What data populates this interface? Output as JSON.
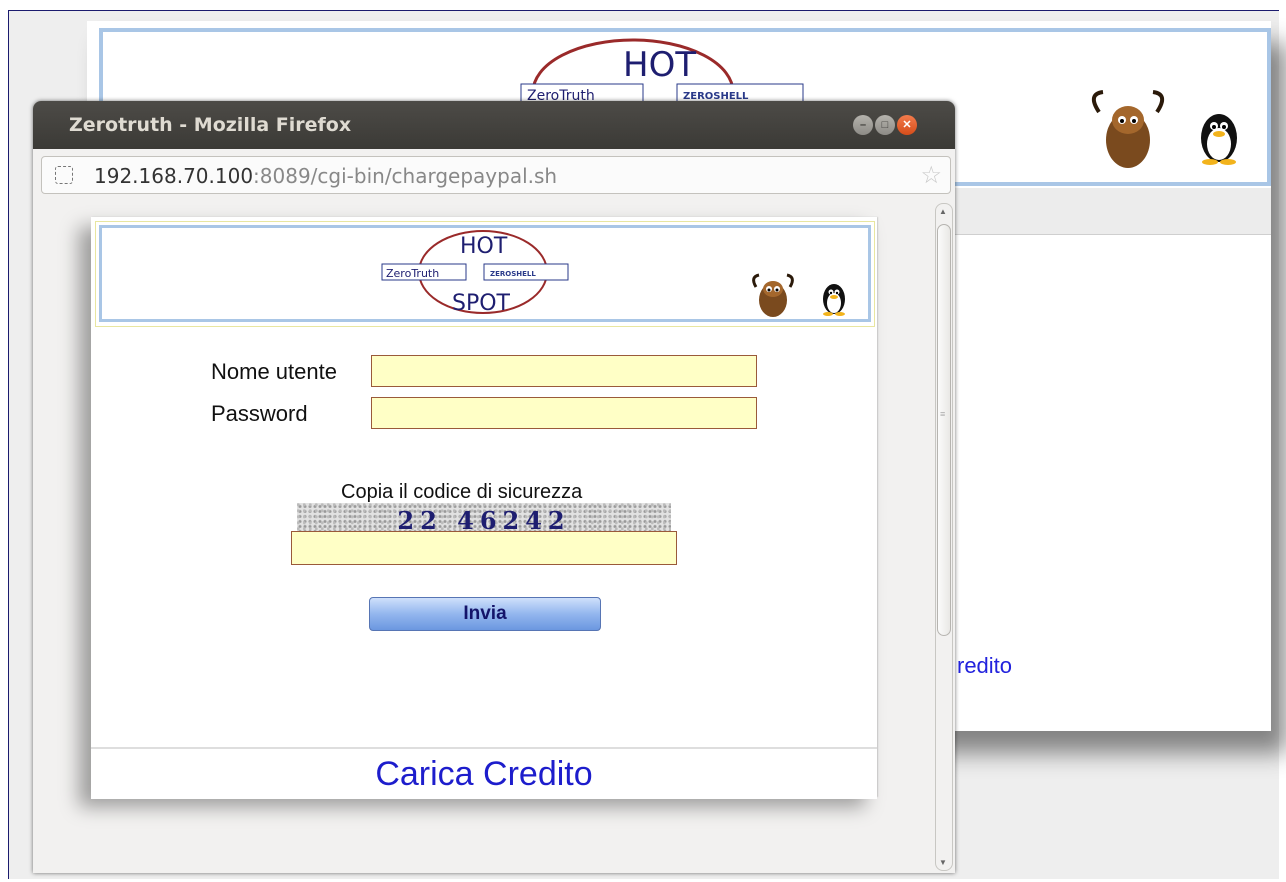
{
  "window": {
    "title": "Zerotruth - Mozilla Firefox",
    "url_host": "192.168.70.100",
    "url_rest": ":8089/cgi-bin/chargepaypal.sh"
  },
  "logo": {
    "top_word": "HOT",
    "bottom_word": "SPOT",
    "badge_left": "ZeroTruth",
    "badge_right": "ZEROSHELL"
  },
  "login": {
    "username_label": "Nome utente",
    "password_label": "Password",
    "username_value": "",
    "password_value": ""
  },
  "captcha": {
    "label": "Copia il codice di sicurezza",
    "code": "22 46242",
    "value": ""
  },
  "submit_label": "Invia",
  "footer_link": "Carica Credito",
  "background_page": {
    "partial_link": "redito"
  },
  "icons": [
    "site-identity-icon",
    "bookmark-star-icon",
    "gnu-mascot-icon",
    "tux-penguin-icon",
    "minimize-icon",
    "maximize-icon",
    "close-icon"
  ],
  "colors": {
    "title_bar": "#3b3a36",
    "input_fill": "#ffffc6",
    "link": "#1d1dcc",
    "header_border": "#a9c6e6",
    "button": "#93b6ee"
  }
}
